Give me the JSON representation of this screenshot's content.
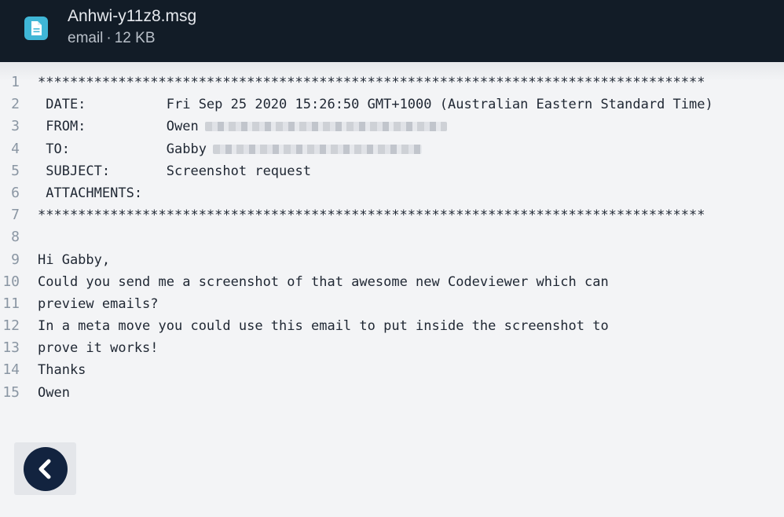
{
  "header": {
    "filename": "Anhwi-y11z8.msg",
    "file_type": "email",
    "separator": "·",
    "file_size": "12 KB",
    "icon": "file-document-icon",
    "icon_color": "#3fb6d6"
  },
  "code": {
    "lines": [
      {
        "n": "1",
        "text": "***********************************************************************************"
      },
      {
        "n": "2",
        "text": " DATE:          Fri Sep 25 2020 15:26:50 GMT+1000 (Australian Eastern Standard Time)"
      },
      {
        "n": "3",
        "text": " FROM:          Owen"
      },
      {
        "n": "4",
        "text": " TO:            Gabby"
      },
      {
        "n": "5",
        "text": " SUBJECT:       Screenshot request"
      },
      {
        "n": "6",
        "text": " ATTACHMENTS:"
      },
      {
        "n": "7",
        "text": "***********************************************************************************"
      },
      {
        "n": "8",
        "text": ""
      },
      {
        "n": "9",
        "text": "Hi Gabby,"
      },
      {
        "n": "10",
        "text": "Could you send me a screenshot of that awesome new Codeviewer which can"
      },
      {
        "n": "11",
        "text": "preview emails?"
      },
      {
        "n": "12",
        "text": "In a meta move you could use this email to put inside the screenshot to"
      },
      {
        "n": "13",
        "text": "prove it works!"
      },
      {
        "n": "14",
        "text": "Thanks"
      },
      {
        "n": "15",
        "text": "Owen"
      }
    ]
  },
  "footer": {
    "back_icon": "chevron-left-icon"
  }
}
